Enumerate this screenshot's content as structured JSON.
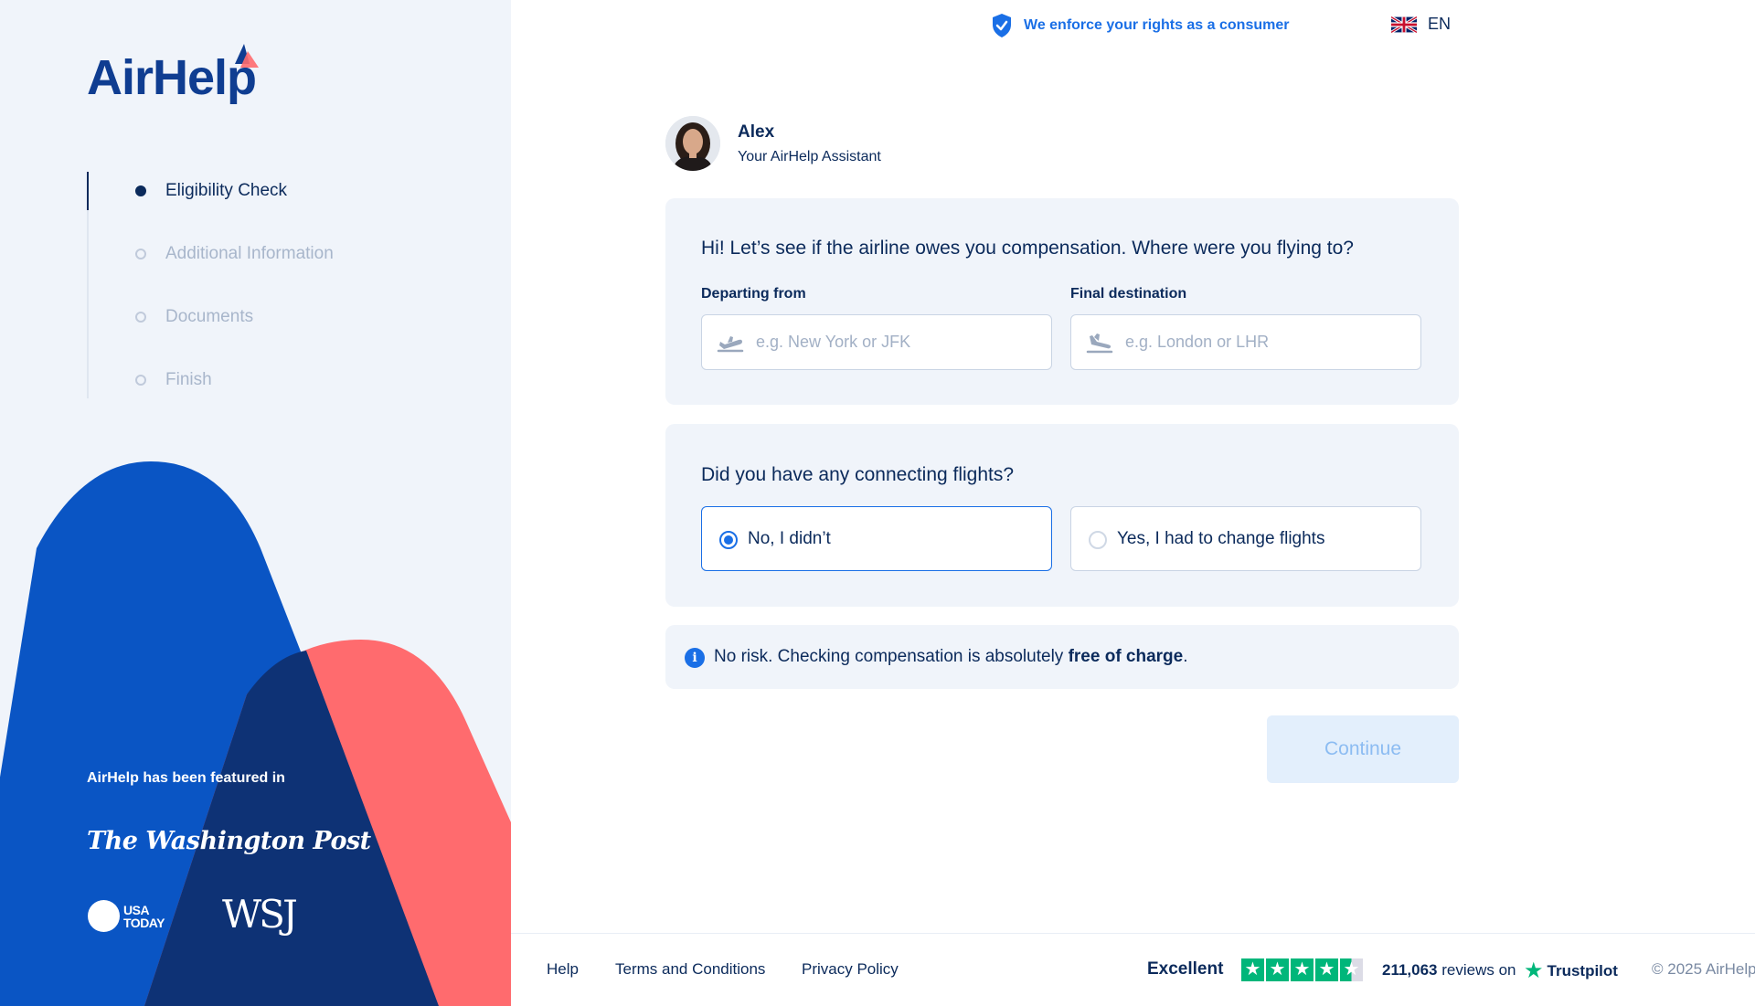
{
  "brand": {
    "name": "AirHelp"
  },
  "steps": [
    {
      "label": "Eligibility Check",
      "active": true
    },
    {
      "label": "Additional Information",
      "active": false
    },
    {
      "label": "Documents",
      "active": false
    },
    {
      "label": "Finish",
      "active": false
    }
  ],
  "featured": {
    "heading": "AirHelp has been featured in",
    "logos": {
      "wapo": "The Washington Post",
      "usa_line1": "USA",
      "usa_line2": "TODAY",
      "wsj": "WSJ"
    }
  },
  "topbar": {
    "enforce_text": "We enforce your rights as a consumer",
    "language": "EN"
  },
  "assistant": {
    "name": "Alex",
    "role": "Your AirHelp Assistant"
  },
  "route_card": {
    "question": "Hi! Let’s see if the airline owes you compensation. Where were you flying to?",
    "departing_label": "Departing from",
    "departing_placeholder": "e.g. New York or JFK",
    "departing_value": "",
    "destination_label": "Final destination",
    "destination_placeholder": "e.g. London or LHR",
    "destination_value": ""
  },
  "connecting_card": {
    "question": "Did you have any connecting flights?",
    "options": [
      {
        "label": "No, I didn’t",
        "selected": true
      },
      {
        "label": "Yes, I had to change flights",
        "selected": false
      }
    ]
  },
  "info": {
    "text_before": "No risk. Checking compensation is absolutely ",
    "text_strong": "free of charge",
    "text_after": "."
  },
  "continue_label": "Continue",
  "footer": {
    "links": [
      "Help",
      "Terms and Conditions",
      "Privacy Policy"
    ],
    "rating_word": "Excellent",
    "rating_stars": 4.5,
    "reviews_count": "211,063",
    "reviews_suffix": " reviews on",
    "trustpilot": "Trustpilot",
    "copyright": "© 2025 AirHelp"
  },
  "colors": {
    "navy": "#0b2a5b",
    "accent": "#1a6fe6",
    "blue_shape": "#0a55c4",
    "dark_shape": "#0e3275",
    "coral_shape": "#ff6b6e",
    "trustpilot_green": "#00b67a"
  },
  "icons": {
    "shield": "shield-check-icon",
    "flag": "uk-flag-icon",
    "plane_depart": "plane-departure-icon",
    "plane_land": "plane-landing-icon",
    "info": "info-icon",
    "star": "star-icon"
  }
}
